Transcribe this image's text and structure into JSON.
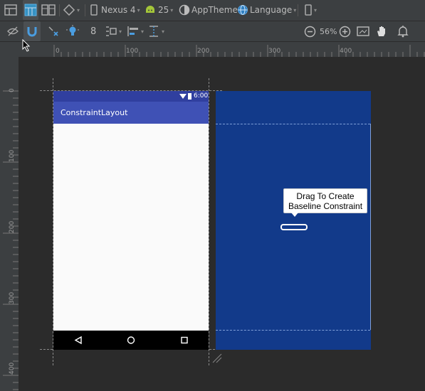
{
  "toolbar": {
    "device": "Nexus 4",
    "api_level": "25",
    "theme": "AppTheme",
    "language": "Language",
    "default_margin": "8",
    "zoom": "56%"
  },
  "rulers": {
    "horizontal": [
      "0",
      "100",
      "200",
      "300",
      "400"
    ],
    "vertical": [
      "0",
      "100",
      "200",
      "300",
      "400"
    ]
  },
  "phone": {
    "status_time": "6:00",
    "app_title": "ConstraintLayout"
  },
  "tooltip": {
    "line1": "Drag To Create",
    "line2": "Baseline Constraint"
  },
  "colors": {
    "primary": "#3f51b5",
    "primary_dark": "#303f9f",
    "blueprint": "#123a8a"
  }
}
